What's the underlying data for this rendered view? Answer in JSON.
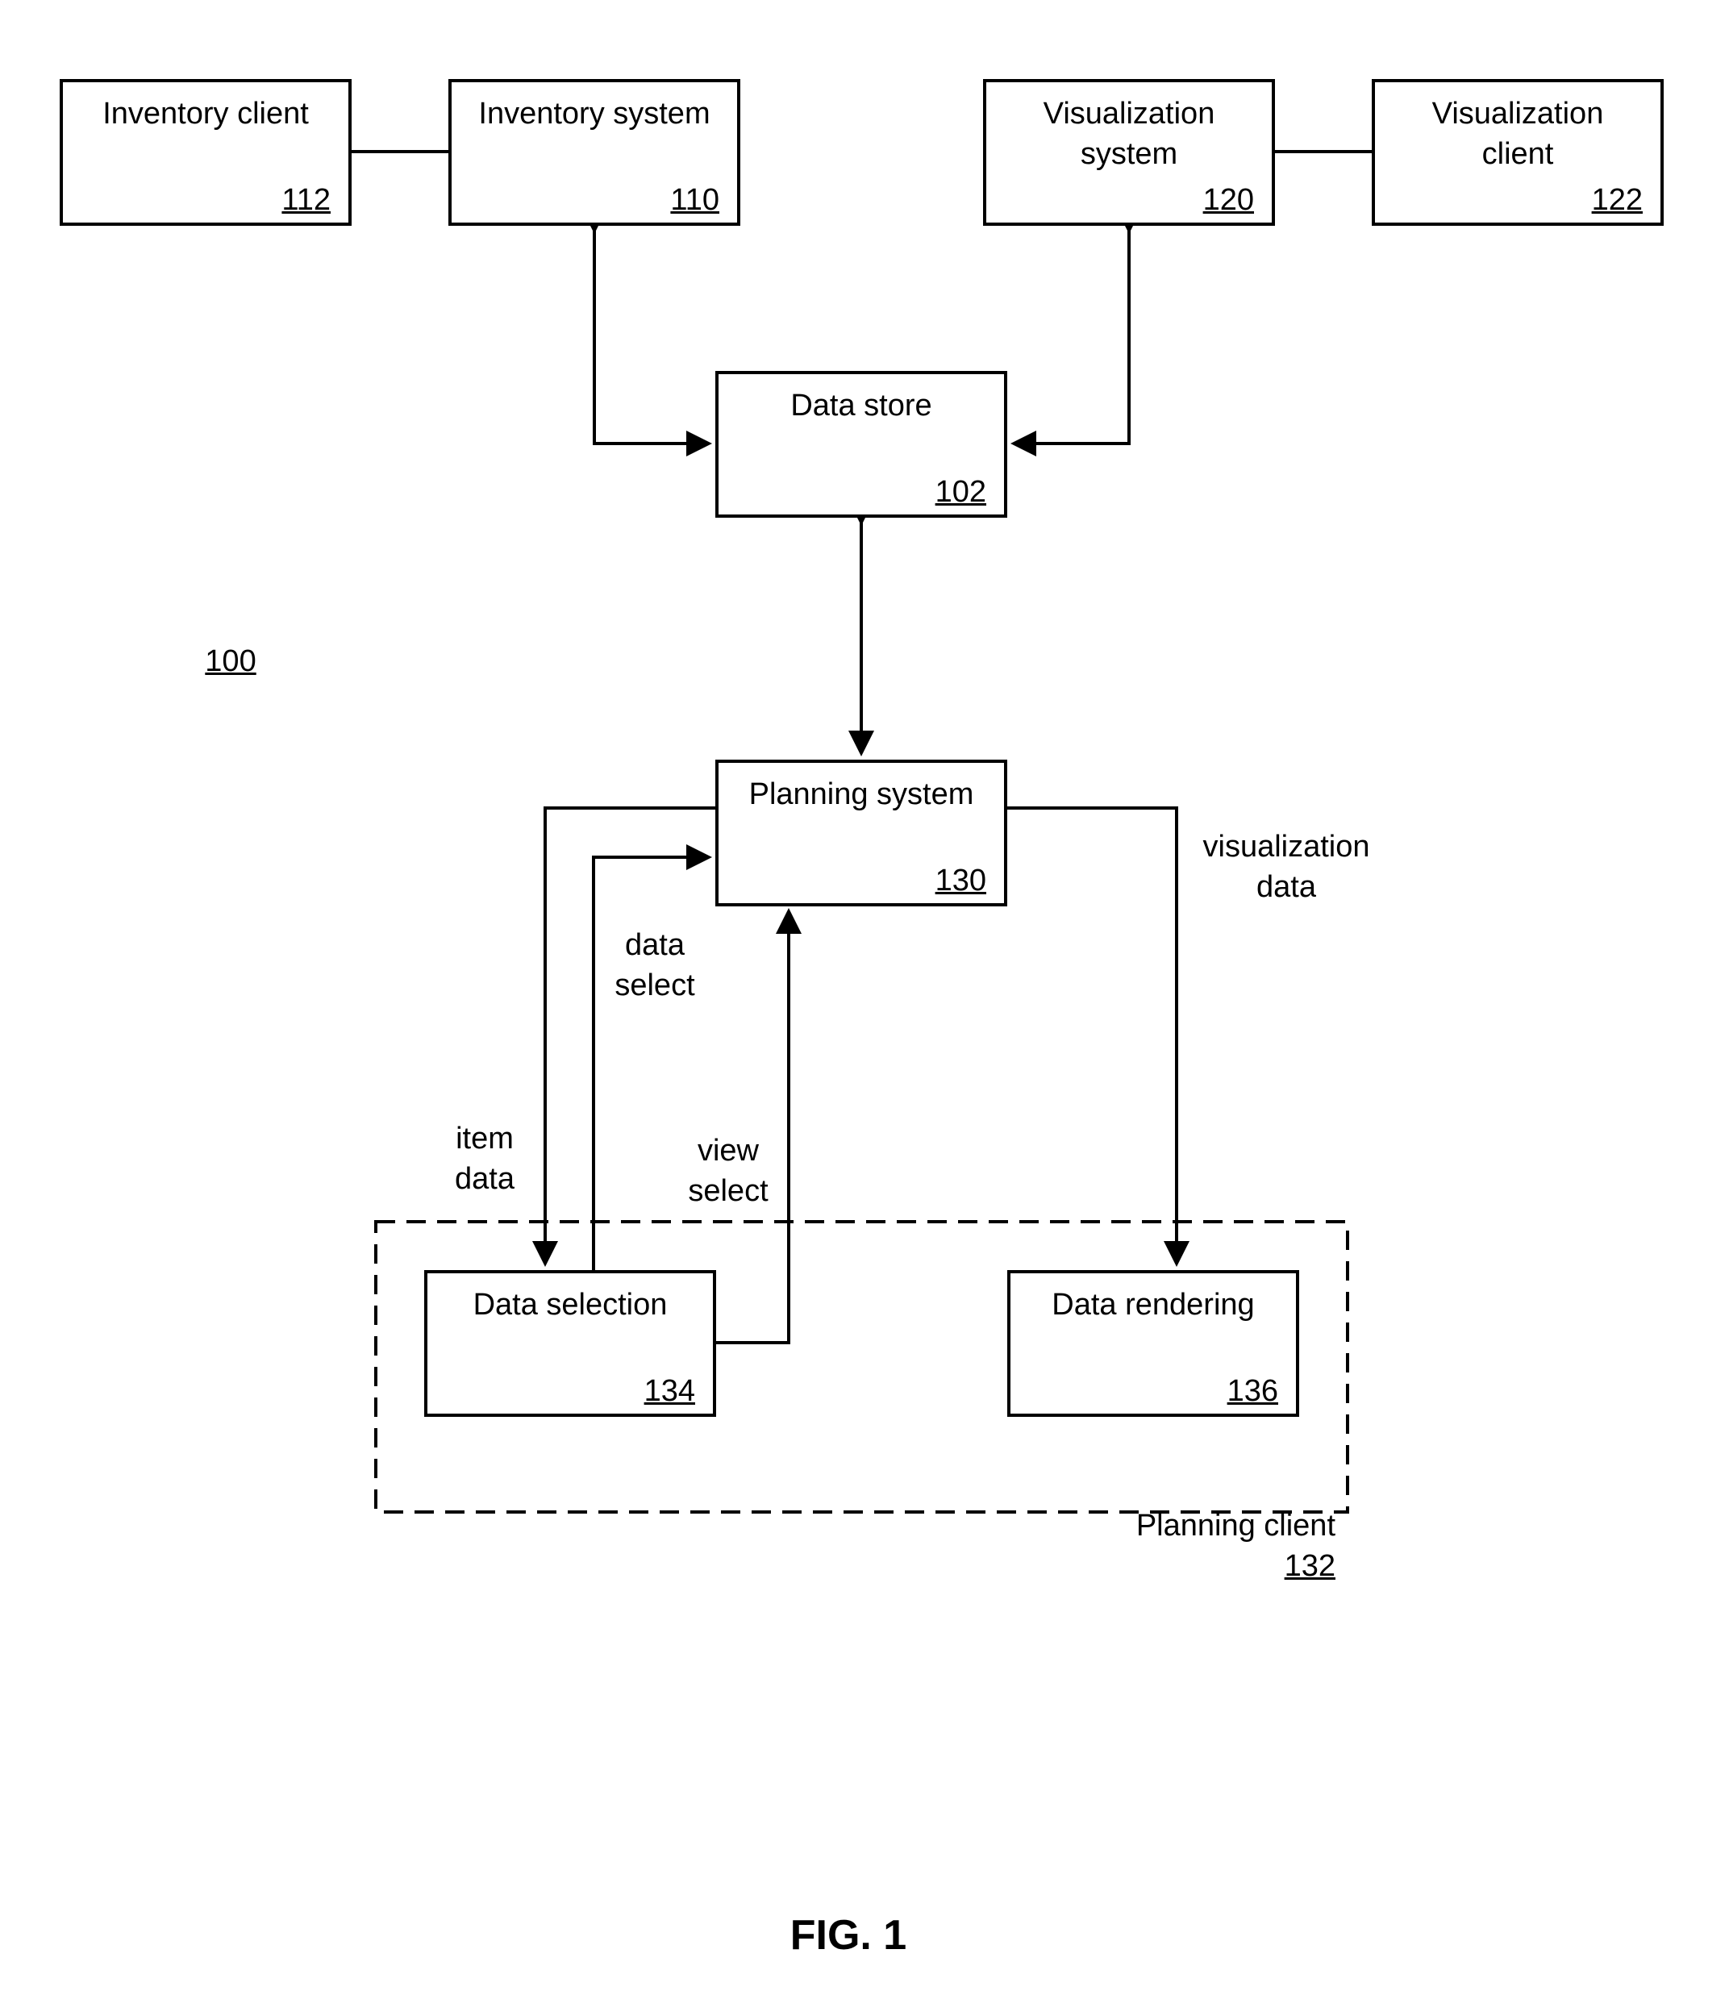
{
  "figure": {
    "label": "FIG. 1",
    "system_ref": "100"
  },
  "boxes": {
    "inventory_client": {
      "title": "Inventory client",
      "ref": "112"
    },
    "inventory_system": {
      "title": "Inventory system",
      "ref": "110"
    },
    "visualization_system": {
      "title": "Visualization\nsystem",
      "ref": "120"
    },
    "visualization_client": {
      "title": "Visualization\nclient",
      "ref": "122"
    },
    "data_store": {
      "title": "Data store",
      "ref": "102"
    },
    "planning_system": {
      "title": "Planning system",
      "ref": "130"
    },
    "data_selection": {
      "title": "Data selection",
      "ref": "134"
    },
    "data_rendering": {
      "title": "Data rendering",
      "ref": "136"
    }
  },
  "group": {
    "planning_client": {
      "title": "Planning client",
      "ref": "132"
    }
  },
  "edge_labels": {
    "visualization_data": "visualization\ndata",
    "data_select": "data\nselect",
    "item_data": "item\ndata",
    "view_select": "view\nselect"
  }
}
